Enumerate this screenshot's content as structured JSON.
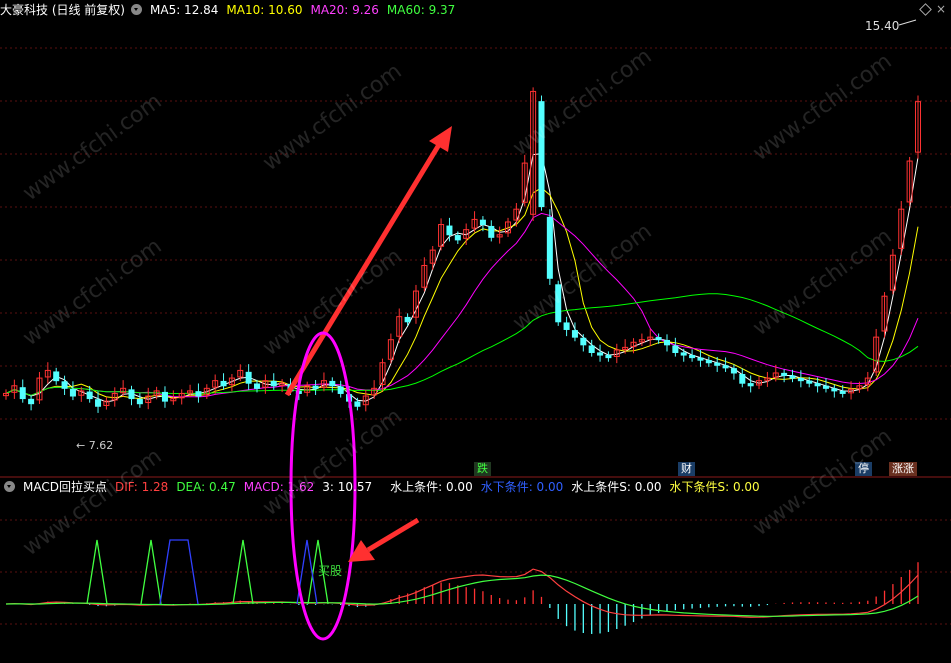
{
  "header": {
    "stock_title": "大豪科技 (日线 前复权)",
    "ma5": "MA5: 12.84",
    "ma10": "MA10: 10.60",
    "ma20": "MA20: 9.26",
    "ma60": "MA60: 9.37"
  },
  "indicator_header": {
    "name": "MACD回拉买点",
    "dif": "DIF: 1.28",
    "dea": "DEA: 0.47",
    "macd": "MACD: 1.62",
    "extra": "3: 10.57",
    "s1": "水上条件: 0.00",
    "s2": "水下条件: 0.00",
    "s3": "水上条件S: 0.00",
    "s4": "水下条件S: 0.00"
  },
  "price_label": "15.40",
  "low_label": "7.62",
  "events": [
    "跌",
    "财",
    "停",
    "涨涨"
  ],
  "buy_label": "买股",
  "watermark": "www.cfchi.com",
  "colors": {
    "up": "#ff3232",
    "down": "#54ffff",
    "ma5": "#ffffff",
    "ma10": "#ffff00",
    "ma20": "#ff00ff",
    "ma60": "#00ff00",
    "dif": "#ff4040",
    "dea": "#40ff40",
    "annotation": "#ff3030",
    "ellipse": "#ff00ff"
  },
  "chart_data": {
    "type": "candlestick",
    "ylim": [
      7.0,
      15.4
    ],
    "closes": [
      8.3,
      8.45,
      8.2,
      8.1,
      8.6,
      8.75,
      8.55,
      8.4,
      8.25,
      8.35,
      8.2,
      8.05,
      8.15,
      8.3,
      8.4,
      8.2,
      8.1,
      8.25,
      8.35,
      8.15,
      8.2,
      8.3,
      8.35,
      8.25,
      8.4,
      8.55,
      8.45,
      8.6,
      8.75,
      8.5,
      8.4,
      8.55,
      8.45,
      8.5,
      8.35,
      8.3,
      8.45,
      8.4,
      8.55,
      8.45,
      8.3,
      8.15,
      8.05,
      8.25,
      8.4,
      8.9,
      9.35,
      9.8,
      9.7,
      10.3,
      10.8,
      11.1,
      11.6,
      11.4,
      11.3,
      11.5,
      11.7,
      11.6,
      11.35,
      11.4,
      11.65,
      11.9,
      12.8,
      14.2,
      11.95,
      10.55,
      9.7,
      9.55,
      9.4,
      9.25,
      9.1,
      9.05,
      9.0,
      9.15,
      9.2,
      9.3,
      9.35,
      9.4,
      9.35,
      9.25,
      9.1,
      9.05,
      9.0,
      8.95,
      8.9,
      8.85,
      8.8,
      8.7,
      8.5,
      8.45,
      8.55,
      8.6,
      8.7,
      8.65,
      8.6,
      8.55,
      8.5,
      8.45,
      8.4,
      8.35,
      8.3,
      8.38,
      8.45,
      8.6,
      9.4,
      10.2,
      11.0,
      11.9,
      12.84,
      14.0
    ],
    "ma5_last": 12.84,
    "ma10_last": 10.6,
    "ma20_last": 9.26,
    "ma60_last": 9.37,
    "macd": {
      "dif_last": 1.28,
      "dea_last": 0.47,
      "macd_last": 1.62
    }
  }
}
